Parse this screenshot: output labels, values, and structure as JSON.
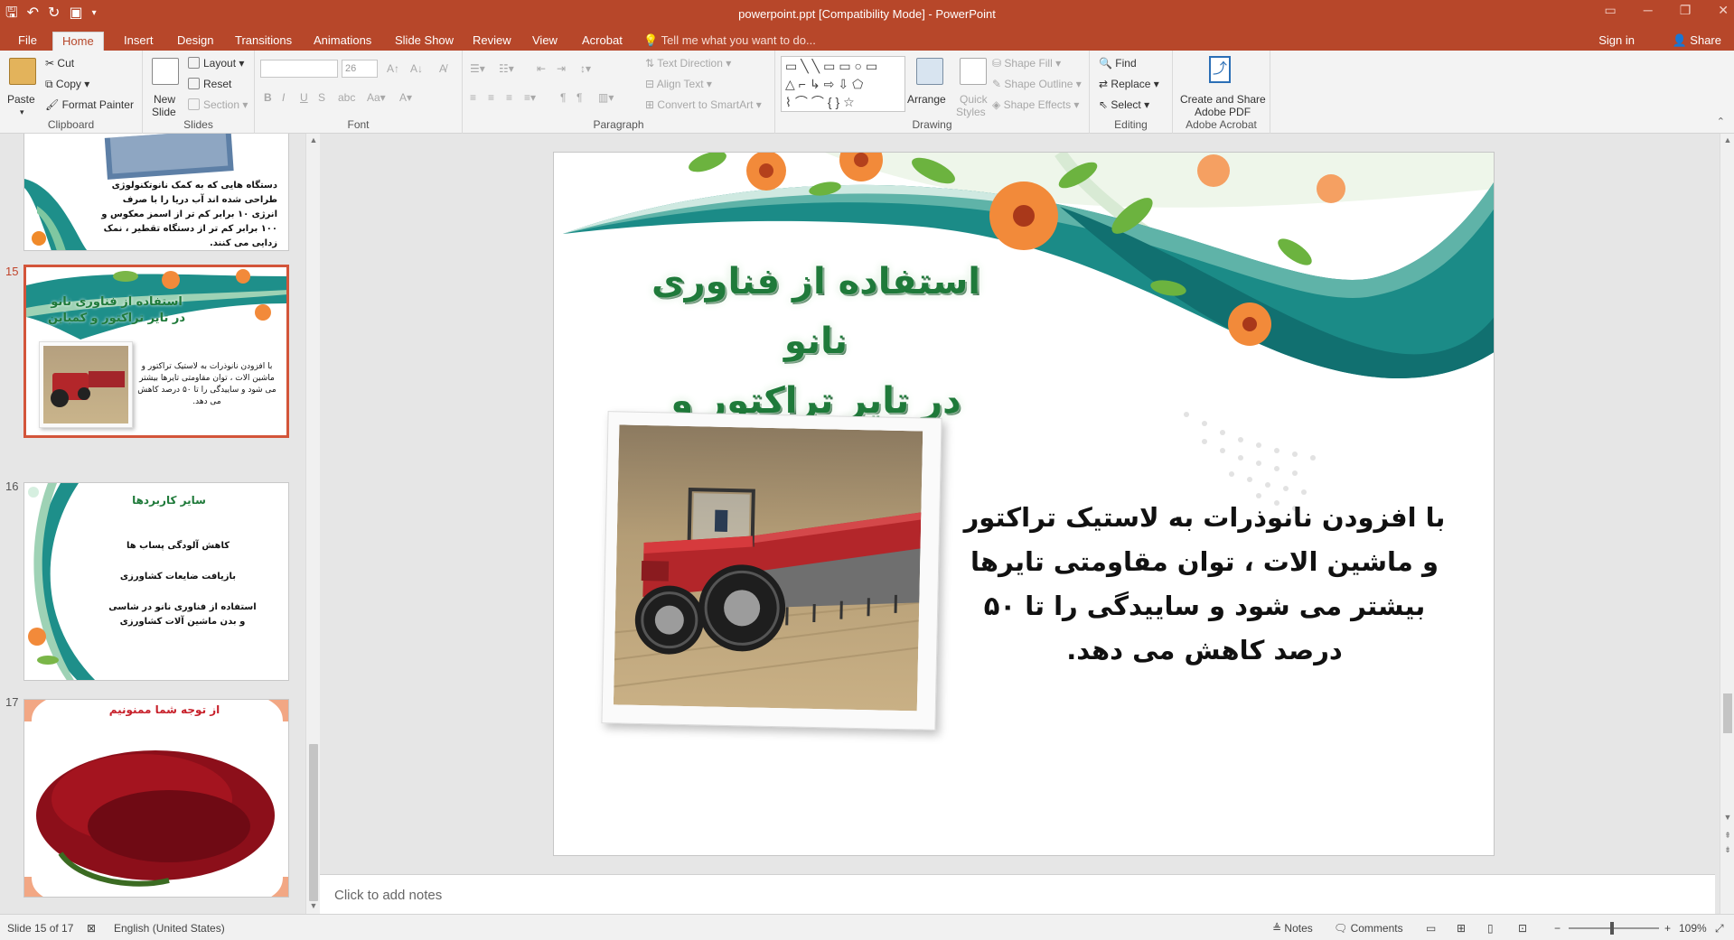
{
  "app": {
    "doc_title": "powerpoint.ppt [Compatibility Mode] - PowerPoint",
    "accent": "#b7472a"
  },
  "tabs": [
    {
      "label": "File"
    },
    {
      "label": "Home"
    },
    {
      "label": "Insert"
    },
    {
      "label": "Design"
    },
    {
      "label": "Transitions"
    },
    {
      "label": "Animations"
    },
    {
      "label": "Slide Show"
    },
    {
      "label": "Review"
    },
    {
      "label": "View"
    },
    {
      "label": "Acrobat"
    }
  ],
  "tellme": "Tell me what you want to do...",
  "signin": "Sign in",
  "share": "Share",
  "ribbon": {
    "clipboard": {
      "paste": "Paste",
      "cut": "Cut",
      "copy": "Copy",
      "format_painter": "Format Painter",
      "label": "Clipboard"
    },
    "slides": {
      "new_slide": "New",
      "new_slide2": "Slide",
      "layout": "Layout",
      "reset": "Reset",
      "section": "Section",
      "label": "Slides"
    },
    "font": {
      "size": "26",
      "bold": "B",
      "italic": "I",
      "underline": "U",
      "strike": "S",
      "label": "Font"
    },
    "paragraph": {
      "text_direction": "Text Direction",
      "align_text": "Align Text",
      "smartart": "Convert to SmartArt",
      "label": "Paragraph"
    },
    "drawing": {
      "arrange": "Arrange",
      "quick_styles": "Quick",
      "quick_styles2": "Styles",
      "shape_fill": "Shape Fill",
      "shape_outline": "Shape Outline",
      "shape_effects": "Shape Effects",
      "label": "Drawing"
    },
    "editing": {
      "find": "Find",
      "replace": "Replace",
      "select": "Select",
      "label": "Editing"
    },
    "acrobat": {
      "create_share": "Create and Share",
      "adobe_pdf": "Adobe PDF",
      "label": "Adobe Acrobat"
    }
  },
  "thumbnails": {
    "t14": {
      "text": "دستگاه هایی که به کمک نانوتکنولوژی طراحی شده اند آب دریا را با صرف انرژی ۱۰ برابر کم تر از اسمز معکوس و ۱۰۰ برابر کم تر از دستگاه تقطیر ، نمک زدایی می کنند."
    },
    "t15": {
      "num": "15",
      "title1": "استفاده از فناوری نانو",
      "title2": "در تایر تراکتور و کمباین",
      "body": "با افزودن نانوذرات به لاستیک تراکتور و ماشین الات ، توان مقاومتی تایرها بیشتر می شود و ساییدگی را تا ۵۰ درصد کاهش می دهد."
    },
    "t16": {
      "num": "16",
      "title": "سایر کاربردها",
      "line1": "کاهش آلودگی پساب ها",
      "line2": "بازیافت ضایعات کشاورزی",
      "line3": "استفاده از فناوری نانو در شاسی و بدن ماشین آلات کشاورزی"
    },
    "t17": {
      "num": "17",
      "title": "از توجه شما ممنونیم"
    }
  },
  "slide": {
    "title_line1": "استفاده از فناوری نانو",
    "title_line2": "در تایر تراکتور و کمباین",
    "body": "با افزودن نانوذرات به لاستیک تراکتور و ماشین الات ، توان مقاومتی تایرها بیشتر می شود و ساییدگی را تا ۵۰ درصد کاهش می دهد."
  },
  "notes_placeholder": "Click to add notes",
  "status": {
    "slide_of": "Slide 15 of 17",
    "language": "English (United States)",
    "notes": "Notes",
    "comments": "Comments",
    "zoom": "109%"
  }
}
